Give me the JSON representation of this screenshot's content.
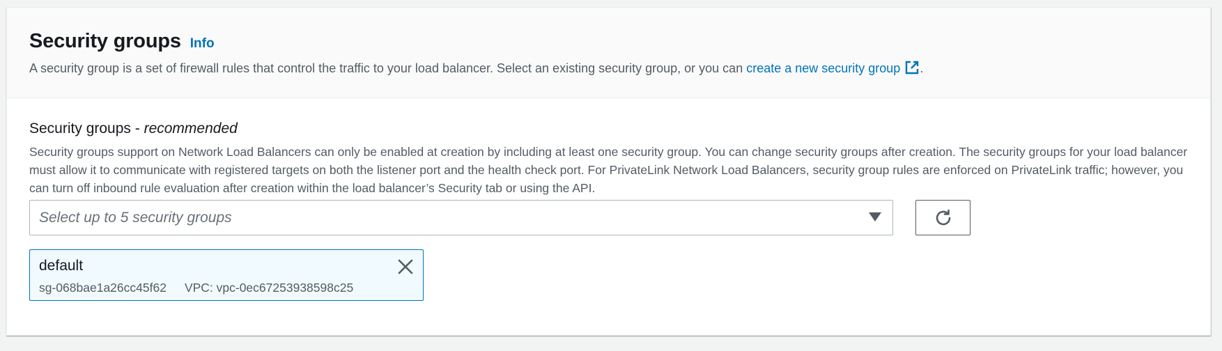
{
  "section": {
    "title": "Security groups",
    "info_label": "Info",
    "description_prefix": "A security group is a set of firewall rules that control the traffic to your load balancer. Select an existing security group, or you can ",
    "description_link": "create a new security group",
    "description_suffix": "."
  },
  "field": {
    "label": "Security groups - ",
    "label_emphasis": "recommended",
    "description": "Security groups support on Network Load Balancers can only be enabled at creation by including at least one security group. You can change security groups after creation. The security groups for your load balancer must allow it to communicate with registered targets on both the listener port and the health check port. For PrivateLink Network Load Balancers, security group rules are enforced on PrivateLink traffic; however, you can turn off inbound rule evaluation after creation within the load balancer’s Security tab or using the API."
  },
  "select": {
    "placeholder": "Select up to 5 security groups"
  },
  "selected_groups": [
    {
      "name": "default",
      "id": "sg-068bae1a26cc45f62",
      "vpc": "VPC: vpc-0ec67253938598c25"
    }
  ],
  "icons": {
    "external_link": "external-link-icon",
    "dropdown": "caret-down-icon",
    "refresh": "refresh-icon",
    "remove": "close-icon"
  },
  "colors": {
    "link": "#0073bb",
    "text_primary": "#16191f",
    "text_secondary": "#545b64",
    "token_background": "#f1faff",
    "token_border": "#0073bb"
  }
}
